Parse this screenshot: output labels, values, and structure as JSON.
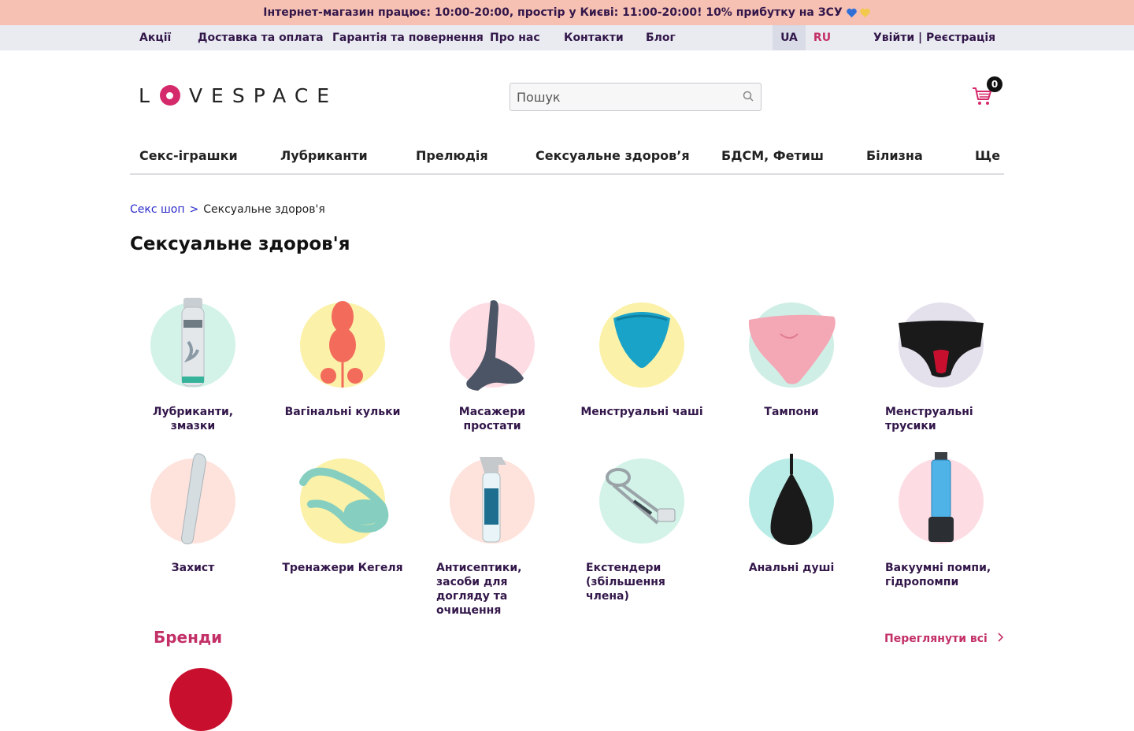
{
  "announcement": {
    "text": "Інтернет-магазин працює: 10:00-20:00, простір у Києві: 11:00-20:00! 10% прибутку на ЗСУ",
    "heart_colors": [
      "#2f6fd6",
      "#f2c94c"
    ]
  },
  "topnav": {
    "links": [
      "Акції",
      "Доставка та оплата",
      "Гарантія та повернення",
      "Про нас",
      "Контакти",
      "Блог"
    ],
    "languages": [
      "UA",
      "RU"
    ],
    "active_language": "UA",
    "auth": "Увійти | Реєстрація"
  },
  "header": {
    "logo_text": "VESPACE",
    "logo_letter": "L",
    "search_placeholder": "Пошук",
    "cart_count": "0",
    "brand_color": "#d42a6b"
  },
  "category_nav": [
    "Секс-іграшки",
    "Лубриканти",
    "Прелюдія",
    "Сексуальне здоров’я",
    "БДСМ, Фетиш",
    "Білизна",
    "Ще"
  ],
  "breadcrumb": {
    "home": "Секс шоп",
    "separator": ">",
    "current": "Сексуальне здоров'я"
  },
  "page_title": "Сексуальне здоров'я",
  "categories": [
    {
      "label": "Лубриканти, змазки",
      "circle_color": "#d3f3e8",
      "icon": "lubricant-bottle-icon"
    },
    {
      "label": "Вагінальні кульки",
      "circle_color": "#fbf1a8",
      "icon": "vaginal-balls-icon"
    },
    {
      "label": "Масажери простати",
      "circle_color": "#fddde3",
      "icon": "prostate-massager-icon"
    },
    {
      "label": "Менструальні чаші",
      "circle_color": "#fbf1a8",
      "icon": "menstrual-cup-icon"
    },
    {
      "label": "Тампони",
      "circle_color": "#cfeee5",
      "icon": "tampon-sponge-icon"
    },
    {
      "label": "Менструальні трусики",
      "circle_color": "#e4e1ec",
      "icon": "period-panties-icon"
    },
    {
      "label": "Захист",
      "circle_color": "#fde3dc",
      "icon": "condom-sleeve-icon"
    },
    {
      "label": "Тренажери Кегеля",
      "circle_color": "#fbf1a8",
      "icon": "kegel-trainer-icon"
    },
    {
      "label": "Антисептики, засоби для догляду та очищення",
      "circle_color": "#fde3dc",
      "icon": "spray-bottle-icon"
    },
    {
      "label": "Екстендери (збільшення члена)",
      "circle_color": "#d3f3e8",
      "icon": "extender-icon"
    },
    {
      "label": "Анальні душі",
      "circle_color": "#b9ece6",
      "icon": "anal-douche-icon"
    },
    {
      "label": "Вакуумні помпи, гідропомпи",
      "circle_color": "#fddde3",
      "icon": "vacuum-pump-icon"
    }
  ],
  "brands": {
    "title": "Бренди",
    "view_all": "Переглянути всі"
  }
}
